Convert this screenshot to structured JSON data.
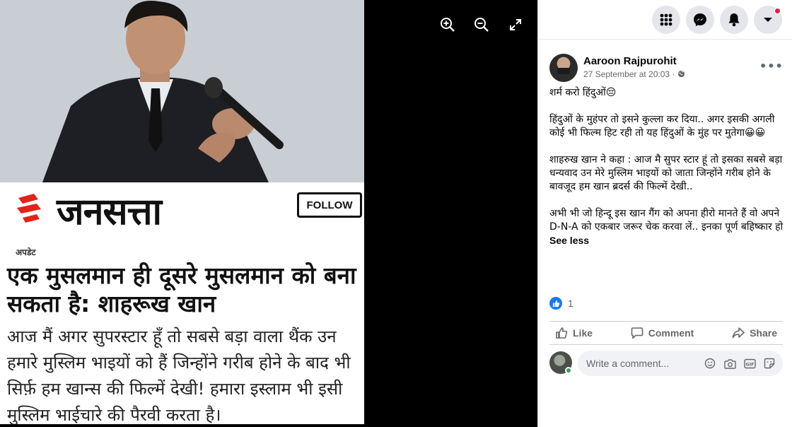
{
  "viewer": {
    "controls": [
      {
        "name": "zoom-in-icon"
      },
      {
        "name": "zoom-out-icon"
      },
      {
        "name": "fullscreen-icon"
      }
    ],
    "photo": {
      "brand": "जनसत्ता",
      "follow_label": "FOLLOW",
      "kicker": "अपडेट",
      "headline": "एक मुसलमान ही दूसरे मुसलमान को बना सकता है: शाहरूख खान",
      "body": "आज मैं अगर सुपरस्टार हूँ तो सबसे बड़ा वाला थैंक उन हमारे मुस्लिम भाइयों को हैं जिन्होंने गरीब होने के बाद भी सिर्फ़ हम खान्स की फिल्में देखी! हमारा इस्लाम भी इसी मुस्लिम भाईचारे की पैरवी करता है।"
    }
  },
  "topbar": {
    "buttons": [
      "menu-grid-icon",
      "messenger-icon",
      "notifications-icon",
      "account-chevron-icon"
    ],
    "colors": {
      "notification_dot": "#e41e3f"
    }
  },
  "post": {
    "author": "Aaroon Rajpurohit",
    "date": "27 September at 20:03 · ",
    "privacy_icon": "globe-icon",
    "more_label": "•••",
    "paragraphs": [
      "शर्म करो हिंदुओं😔",
      "हिंदुओं के मुहंपर तो इसने कुल्ला कर दिया.. अगर इसकी अगली कोई भी फिल्म हिट रही तो यह हिंदुओं के मुंह पर मुतेगा😀😀",
      "शाहरुख खान ने कहा : आज मै सुपर स्टार हूं तो इसका सबसे बड़ा धन्यवाद उन मेरे मुस्लिम भाइयों को जाता जिन्होंने गरीब होने के बावजूद हम खान ब्रदर्स की फिल्में देखी..",
      "अभी भी जो हिन्दू इस खान गैंग को अपना हीरो मानते हैं वो अपने D-N-A को एकबार जरूर चेक करवा लें.. इनका पूर्ण बहिष्कार हो"
    ],
    "see_less": "See less",
    "reaction_count": "1",
    "actions": {
      "like": "Like",
      "comment": "Comment",
      "share": "Share"
    },
    "comment_placeholder": "Write a comment...",
    "colors": {
      "like_blue": "#1877f2",
      "online_green": "#31a24c"
    }
  }
}
